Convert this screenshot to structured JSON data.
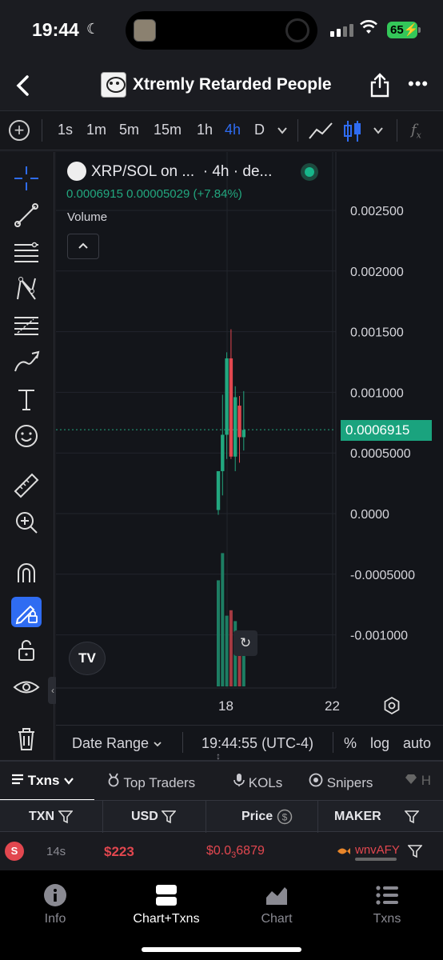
{
  "status_bar": {
    "time": "19:44",
    "battery": "65"
  },
  "header": {
    "title": "Xtremly Retarded People"
  },
  "toolbar": {
    "intervals": [
      "1s",
      "1m",
      "5m",
      "15m",
      "1h",
      "4h",
      "D"
    ],
    "active_interval": "4h",
    "fx_label": "f"
  },
  "legend": {
    "symbol": "XRP/SOL on ...",
    "interval_text": "· 4h · de...",
    "ohlc_value": "0.0006915",
    "change": "0.00005029 (+7.84%)",
    "volume_label": "Volume",
    "volume_toggle": "^"
  },
  "chart_data": {
    "type": "candlestick",
    "y_axis_ticks": [
      "0.002500",
      "0.002000",
      "0.001500",
      "0.001000",
      "0.0005000",
      "0.0000",
      "-0.0005000",
      "-0.001000"
    ],
    "x_axis_ticks": [
      "18",
      "22"
    ],
    "last_price_label": "0.0006915",
    "candles": [
      {
        "open": 3e-05,
        "high": 7e-05,
        "low": -1e-05,
        "close": 0.00035,
        "direction": "up"
      },
      {
        "open": 0.00035,
        "high": 0.00098,
        "low": 0.00015,
        "close": 0.00065,
        "direction": "up"
      },
      {
        "open": 0.00065,
        "high": 0.00133,
        "low": 0.00045,
        "close": 0.00128,
        "direction": "up"
      },
      {
        "open": 0.00128,
        "high": 0.00152,
        "low": 0.00045,
        "close": 0.00047,
        "direction": "down"
      },
      {
        "open": 0.00047,
        "high": 0.00105,
        "low": 0.00035,
        "close": 0.00096,
        "direction": "up"
      },
      {
        "open": 0.00089,
        "high": 0.00097,
        "low": 0.00042,
        "close": 0.00063,
        "direction": "down"
      },
      {
        "open": 0.00063,
        "high": 0.00101,
        "low": 0.00052,
        "close": 0.00069,
        "direction": "up"
      }
    ],
    "volume_bars": [
      {
        "value": 0.78,
        "direction": "up"
      },
      {
        "value": 0.98,
        "direction": "up"
      },
      {
        "value": 0.52,
        "direction": "up"
      },
      {
        "value": 0.56,
        "direction": "down"
      },
      {
        "value": 0.48,
        "direction": "up"
      },
      {
        "value": 0.36,
        "direction": "down"
      },
      {
        "value": 0.32,
        "direction": "up"
      }
    ],
    "colors": {
      "up": "#22a77f",
      "down": "#e2474f"
    }
  },
  "chart_bottom": {
    "date_range": "Date Range",
    "timestamp": "19:44:55 (UTC-4)",
    "percent": "%",
    "log": "log",
    "auto": "auto"
  },
  "txn_tabs": {
    "txns": "Txns",
    "top_traders": "Top Traders",
    "kols": "KOLs",
    "snipers": "Snipers",
    "holders": "H"
  },
  "table": {
    "headers": {
      "txn": "TXN",
      "usd": "USD",
      "price": "Price",
      "maker": "MAKER"
    },
    "rows": [
      {
        "type": "S",
        "age": "14s",
        "usd": "$223",
        "price_prefix": "$0.0",
        "price_zeros": "3",
        "price_digits": "6879",
        "maker": "wnvAFY"
      }
    ]
  },
  "bottom_nav": {
    "items": [
      {
        "label": "Info",
        "icon": "info-icon"
      },
      {
        "label": "Chart+Txns",
        "icon": "chart-txns-icon"
      },
      {
        "label": "Chart",
        "icon": "chart-icon"
      },
      {
        "label": "Txns",
        "icon": "list-icon"
      }
    ],
    "active": "Chart+Txns"
  }
}
